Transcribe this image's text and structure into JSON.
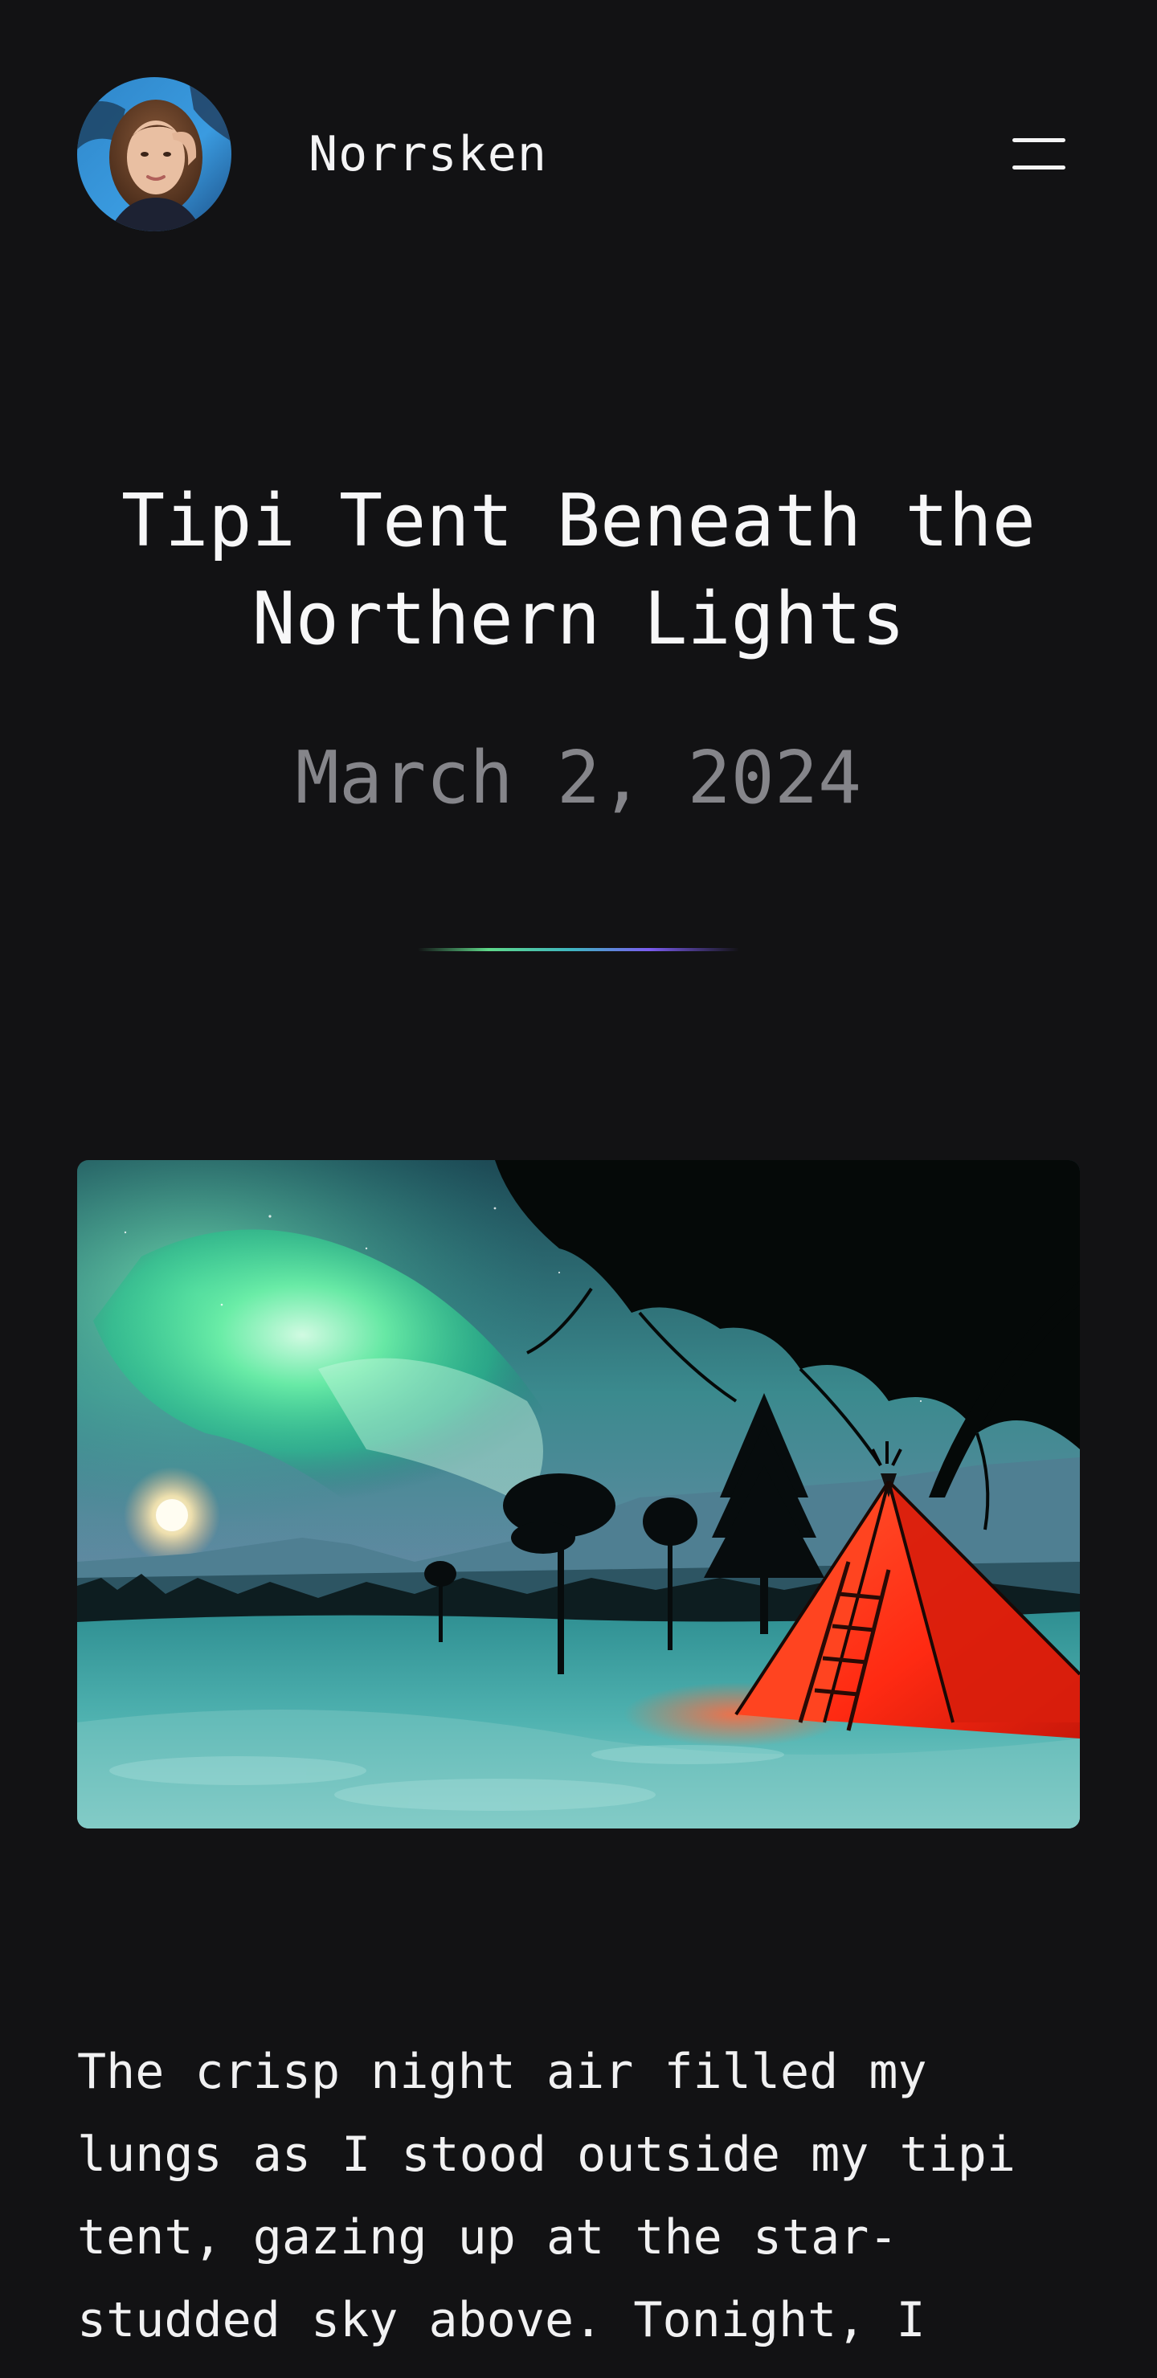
{
  "header": {
    "site_name": "Norrsken",
    "avatar_icon": "author-avatar",
    "menu_icon": "hamburger-menu-icon"
  },
  "post": {
    "title": "Tipi Tent Beneath the Northern Lights",
    "date": "March 2, 2024",
    "hero_image": "aurora-tipi-tent-photo",
    "body": "The crisp night air filled my lungs as I stood outside my tipi tent, gazing up at the star-studded sky above. Tonight, I"
  },
  "colors": {
    "background": "#121214",
    "text": "#f4f4f5",
    "muted": "#85858a",
    "divider_gradient": [
      "#5fd88a",
      "#3fb6c2",
      "#7b5cf0"
    ]
  }
}
